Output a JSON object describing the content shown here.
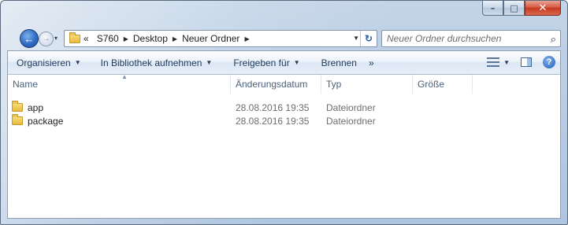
{
  "window": {
    "minimize_symbol": "–",
    "maximize_symbol": "□",
    "close_symbol": "✕"
  },
  "nav": {
    "back_icon": "back-arrow-icon",
    "forward_icon": "forward-arrow-icon",
    "history_dropdown": "▾",
    "breadcrumb": {
      "overflow": "«",
      "items": [
        "S760",
        "Desktop",
        "Neuer Ordner"
      ]
    },
    "refresh_symbol": "↻",
    "search_placeholder": "Neuer Ordner durchsuchen"
  },
  "toolbar": {
    "items": [
      {
        "label": "Organisieren",
        "has_arrow": true
      },
      {
        "label": "In Bibliothek aufnehmen",
        "has_arrow": true
      },
      {
        "label": "Freigeben für",
        "has_arrow": true
      },
      {
        "label": "Brennen",
        "has_arrow": false
      }
    ],
    "more": "»",
    "help_symbol": "?"
  },
  "columns": {
    "name": "Name",
    "date": "Änderungsdatum",
    "type": "Typ",
    "size": "Größe"
  },
  "files": [
    {
      "name": "app",
      "date": "28.08.2016 19:35",
      "type": "Dateiordner",
      "size": ""
    },
    {
      "name": "package",
      "date": "28.08.2016 19:35",
      "type": "Dateiordner",
      "size": ""
    }
  ],
  "colors": {
    "frame": "#b9cde4",
    "toolbar_text": "#1e395b",
    "close_button": "#c4381e"
  }
}
